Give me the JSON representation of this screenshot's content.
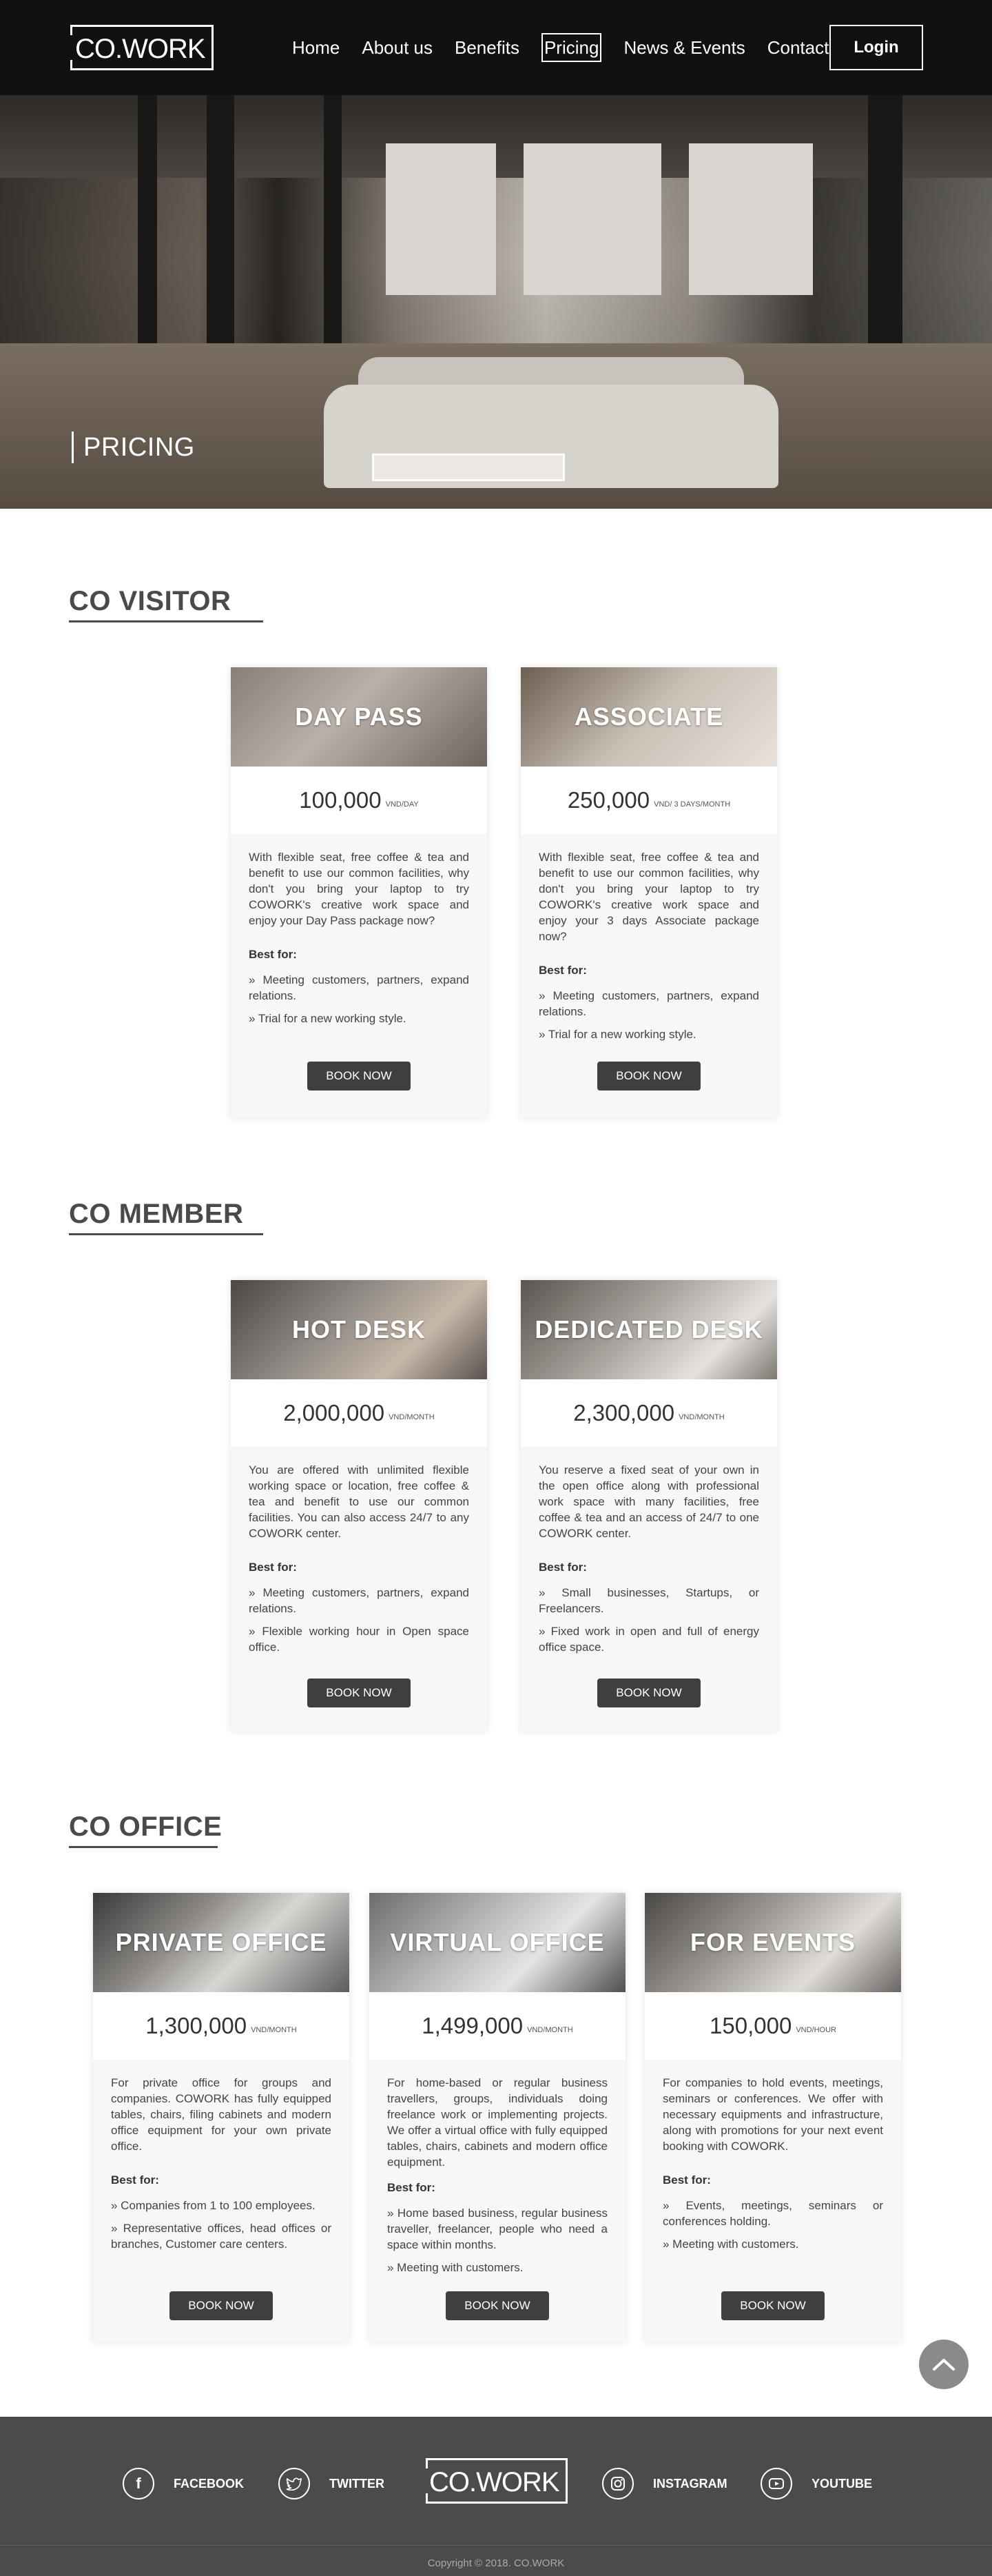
{
  "brand": {
    "logo_text": "CO.WORK"
  },
  "nav": {
    "items": [
      {
        "label": "Home"
      },
      {
        "label": "About us"
      },
      {
        "label": "Benefits"
      },
      {
        "label": "Pricing"
      },
      {
        "label": "News & Events"
      },
      {
        "label": "Contact"
      }
    ],
    "active": "Pricing",
    "login_label": "Login"
  },
  "hero": {
    "title": "PRICING"
  },
  "sections": {
    "visitor": {
      "title": "CO VISITOR",
      "cards": [
        {
          "title": "DAY PASS",
          "price": "100,000",
          "unit": "VND/DAY",
          "description": "With flexible seat, free coffee & tea and benefit to use our common facilities, why don't you bring your laptop to try COWORK's creative work space and enjoy your Day Pass package now?",
          "best_for_label": "Best for:",
          "bullets": [
            "» Meeting customers, partners, expand relations.",
            "» Trial for a new working style."
          ],
          "button": "BOOK NOW"
        },
        {
          "title": "ASSOCIATE",
          "price": "250,000",
          "unit": "VND/ 3 DAYS/MONTH",
          "description": "With flexible seat, free coffee & tea and benefit to use our common facilities, why don't you bring your laptop to try COWORK's creative work space and enjoy your 3 days Associate package now?",
          "best_for_label": "Best for:",
          "bullets": [
            "» Meeting customers, partners, expand relations.",
            "» Trial for a new working style."
          ],
          "button": "BOOK NOW"
        }
      ]
    },
    "member": {
      "title": "CO MEMBER",
      "cards": [
        {
          "title": "HOT DESK",
          "price": "2,000,000",
          "unit": "VND/MONTH",
          "description": "You are offered with unlimited flexible working space or location, free coffee & tea and benefit to use our common facilities. You can also access 24/7 to any COWORK center.",
          "best_for_label": "Best for:",
          "bullets": [
            "» Meeting customers, partners, expand relations.",
            "» Flexible working hour in Open space office."
          ],
          "button": "BOOK NOW"
        },
        {
          "title": "DEDICATED DESK",
          "price": "2,300,000",
          "unit": "VND/MONTH",
          "description": "You reserve a fixed seat of your own in the open office along with professional work space with many facilities, free coffee & tea and an access of 24/7 to one COWORK center.",
          "best_for_label": "Best for:",
          "bullets": [
            "» Small businesses, Startups, or Freelancers.",
            "» Fixed work in open and full of energy office space."
          ],
          "button": "BOOK NOW"
        }
      ]
    },
    "office": {
      "title": "CO OFFICE",
      "cards": [
        {
          "title": "PRIVATE OFFICE",
          "price": "1,300,000",
          "unit": "VND/MONTH",
          "description": "For private office for groups and companies. COWORK has fully equipped tables, chairs, filing cabinets and modern office equipment for your own private office.",
          "best_for_label": "Best for:",
          "bullets": [
            "» Companies from 1 to 100 employees.",
            "» Representative offices, head offices or branches, Customer care centers."
          ],
          "button": "BOOK NOW"
        },
        {
          "title": "VIRTUAL OFFICE",
          "price": "1,499,000",
          "unit": "VND/MONTH",
          "description": "For home-based or regular business travellers, groups, individuals doing freelance work or implementing projects. We offer a virtual office with fully equipped tables, chairs, cabinets and modern office equipment.",
          "best_for_label": "Best for:",
          "bullets": [
            "» Home based business, regular business traveller, freelancer, people who need a space within months.",
            "» Meeting with customers."
          ],
          "button": "BOOK NOW"
        },
        {
          "title": "FOR EVENTS",
          "price": "150,000",
          "unit": "VND/HOUR",
          "description": "For companies to hold events, meetings, seminars or conferences. We offer with necessary equipments and infrastructure, along with promotions for your next event booking with COWORK.",
          "best_for_label": "Best for:",
          "bullets": [
            "» Events, meetings, seminars or conferences holding.",
            "» Meeting with customers."
          ],
          "button": "BOOK NOW"
        }
      ]
    }
  },
  "footer": {
    "facebook": "FACEBOOK",
    "twitter": "TWITTER",
    "instagram": "INSTAGRAM",
    "youtube": "YOUTUBE",
    "copyright": "Copyright © 2018. CO.WORK"
  },
  "colors": {
    "nav_bg": "#111111",
    "footer_bg": "#4b4b4b",
    "button_bg": "#3f3f3f",
    "card_bg": "#f7f7f7"
  }
}
